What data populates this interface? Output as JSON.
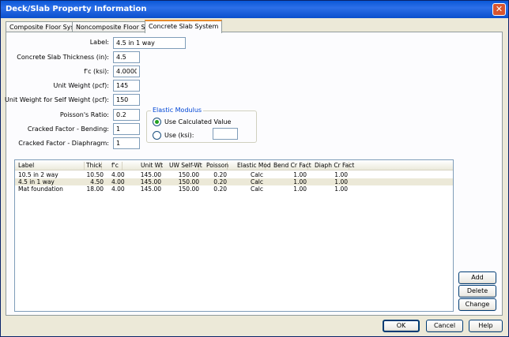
{
  "window": {
    "title": "Deck/Slab Property Information",
    "close_glyph": "✕"
  },
  "tabs": [
    {
      "label": "Composite Floor System"
    },
    {
      "label": "Noncomposite Floor System"
    },
    {
      "label": "Concrete Slab System"
    }
  ],
  "form": {
    "label": {
      "caption": "Label:",
      "value": "4.5 in 1 way"
    },
    "thickness": {
      "caption": "Concrete Slab Thickness  (in):",
      "value": "4.5"
    },
    "fc": {
      "caption": "f'c (ksi):",
      "value": "4.00000"
    },
    "unit_weight": {
      "caption": "Unit Weight (pcf):",
      "value": "145"
    },
    "self_weight": {
      "caption": "Unit Weight for Self Weight (pcf):",
      "value": "150"
    },
    "poisson": {
      "caption": "Poisson's Ratio:",
      "value": "0.2"
    },
    "bending": {
      "caption": "Cracked Factor - Bending:",
      "value": "1"
    },
    "diaphragm": {
      "caption": "Cracked Factor - Diaphragm:",
      "value": "1"
    }
  },
  "elastic_modulus": {
    "title": "Elastic Modulus",
    "use_calculated": "Use Calculated Value",
    "use_ksi": "Use (ksi):",
    "ksi_value": ""
  },
  "table": {
    "headers": [
      "Label",
      "Thick",
      "f'c",
      "Unit Wt",
      "UW Self-Wt",
      "Poisson",
      "Elastic Mod",
      "Bend Cr Fact",
      "Diaph Cr Fact"
    ],
    "rows": [
      [
        "10.5 in 2 way",
        "10.50",
        "4.00",
        "145.00",
        "150.00",
        "0.20",
        "Calc",
        "1.00",
        "1.00"
      ],
      [
        "4.5 in 1 way",
        "4.50",
        "4.00",
        "145.00",
        "150.00",
        "0.20",
        "Calc",
        "1.00",
        "1.00"
      ],
      [
        "Mat foundation",
        "18.00",
        "4.00",
        "145.00",
        "150.00",
        "0.20",
        "Calc",
        "1.00",
        "1.00"
      ]
    ]
  },
  "side_buttons": {
    "add": "Add",
    "delete": "Delete",
    "change": "Change"
  },
  "footer_buttons": {
    "ok": "OK",
    "cancel": "Cancel",
    "help": "Help"
  }
}
